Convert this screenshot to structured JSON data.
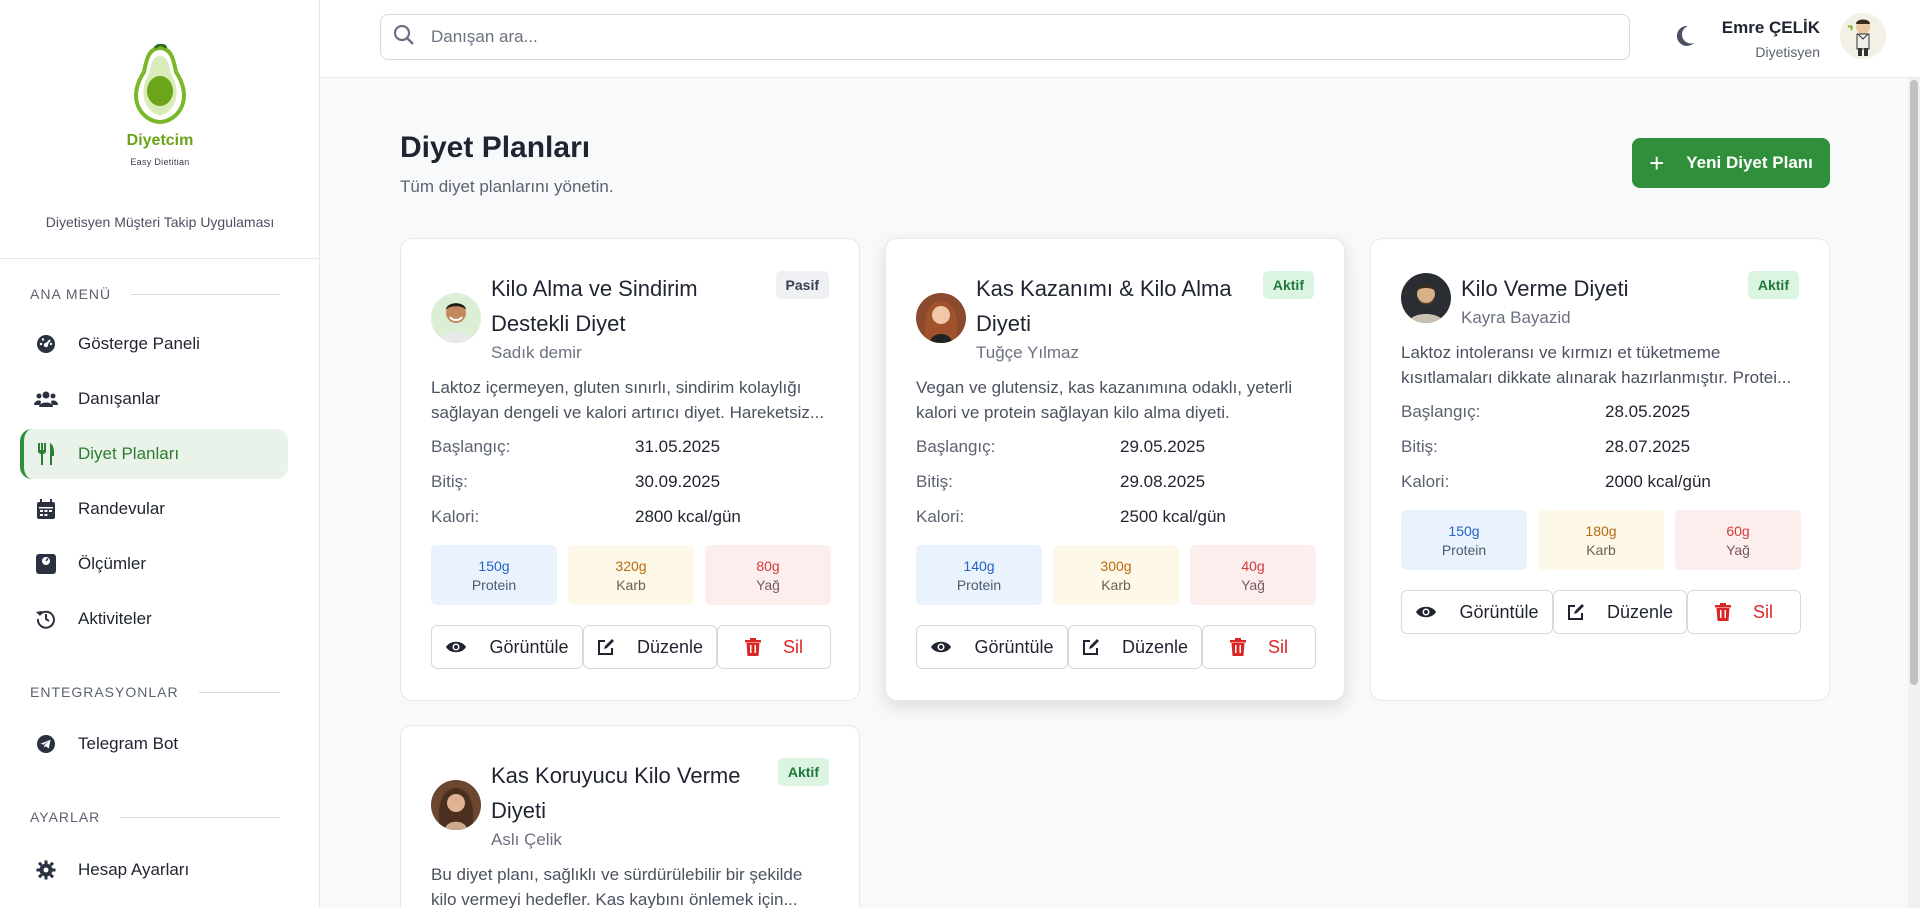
{
  "brand": {
    "name": "Diyetcim",
    "tagline": "Easy Dietitian",
    "description": "Diyetisyen Müşteri Takip Uygulaması"
  },
  "sidebar": {
    "sections": [
      {
        "title": "ANA MENÜ",
        "items": [
          {
            "label": "Gösterge Paneli",
            "icon": "dashboard-gauge-icon"
          },
          {
            "label": "Danışanlar",
            "icon": "users-icon"
          },
          {
            "label": "Diyet Planları",
            "icon": "utensils-icon",
            "active": true
          },
          {
            "label": "Randevular",
            "icon": "calendar-icon"
          },
          {
            "label": "Ölçümler",
            "icon": "weight-scale-icon"
          },
          {
            "label": "Aktiviteler",
            "icon": "history-icon"
          }
        ]
      },
      {
        "title": "ENTEGRASYONLAR",
        "items": [
          {
            "label": "Telegram Bot",
            "icon": "telegram-icon"
          }
        ]
      },
      {
        "title": "AYARLAR",
        "items": [
          {
            "label": "Hesap Ayarları",
            "icon": "gear-icon"
          }
        ]
      }
    ]
  },
  "topbar": {
    "search_placeholder": "Danışan ara...",
    "user_name": "Emre ÇELİK",
    "user_role": "Diyetisyen"
  },
  "page": {
    "title": "Diyet Planları",
    "subtitle": "Tüm diyet planlarını yönetin.",
    "new_button": "Yeni Diyet Planı"
  },
  "labels": {
    "start": "Başlangıç:",
    "end": "Bitiş:",
    "calories": "Kalori:",
    "protein": "Protein",
    "carb": "Karb",
    "fat": "Yağ",
    "view": "Görüntüle",
    "edit": "Düzenle",
    "delete": "Sil"
  },
  "plans": [
    {
      "title": "Kilo Alma ve Sindirim Destekli Diyet",
      "client": "Sadık demir",
      "status": "Pasif",
      "description": "Laktoz içermeyen, gluten sınırlı, sindirim kolaylığı sağlayan dengeli ve kalori artırıcı diyet. Hareketsiz...",
      "start": "31.05.2025",
      "end": "30.09.2025",
      "calories": "2800 kcal/gün",
      "protein": "150g",
      "carb": "320g",
      "fat": "80g"
    },
    {
      "title": "Kas Kazanımı & Kilo Alma Diyeti",
      "client": "Tuğçe Yılmaz",
      "status": "Aktif",
      "description": "Vegan ve glutensiz, kas kazanımına odaklı, yeterli kalori ve protein sağlayan kilo alma diyeti.",
      "start": "29.05.2025",
      "end": "29.08.2025",
      "calories": "2500 kcal/gün",
      "protein": "140g",
      "carb": "300g",
      "fat": "40g"
    },
    {
      "title": "Kilo Verme Diyeti",
      "client": "Kayra Bayazid",
      "status": "Aktif",
      "description": "Laktoz intoleransı ve kırmızı et tüketmeme kısıtlamaları dikkate alınarak hazırlanmıştır. Protei...",
      "start": "28.05.2025",
      "end": "28.07.2025",
      "calories": "2000 kcal/gün",
      "protein": "150g",
      "carb": "180g",
      "fat": "60g"
    },
    {
      "title": "Kas Koruyucu Kilo Verme Diyeti",
      "client": "Aslı Çelik",
      "status": "Aktif",
      "description": "Bu diyet planı, sağlıklı ve sürdürülebilir bir şekilde kilo vermeyi hedefler. Kas kaybını önlemek için..."
    }
  ]
}
